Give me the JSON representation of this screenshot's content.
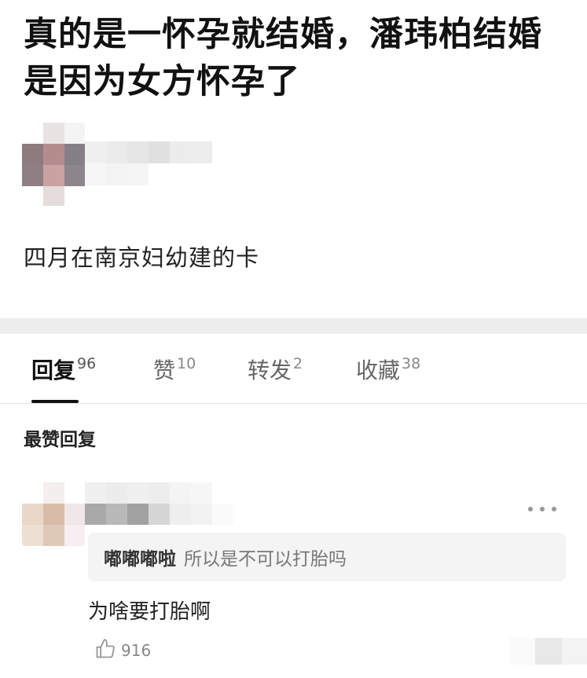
{
  "post": {
    "title": "真的是一怀孕就结婚，潘玮柏结婚是因为女方怀孕了",
    "body": "四月在南京妇幼建的卡"
  },
  "tabs": [
    {
      "label": "回复",
      "count": "96"
    },
    {
      "label": "赞",
      "count": "10"
    },
    {
      "label": "转发",
      "count": "2"
    },
    {
      "label": "收藏",
      "count": "38"
    }
  ],
  "comments": {
    "section_title": "最赞回复",
    "quote_user": "嘟嘟嘟啦",
    "quote_text": "所以是不可以打胎吗",
    "reply_text": "为啥要打胎啊",
    "like_count": "916"
  },
  "icons": {
    "more": "more-dots-icon",
    "like": "thumbs-up-icon"
  }
}
